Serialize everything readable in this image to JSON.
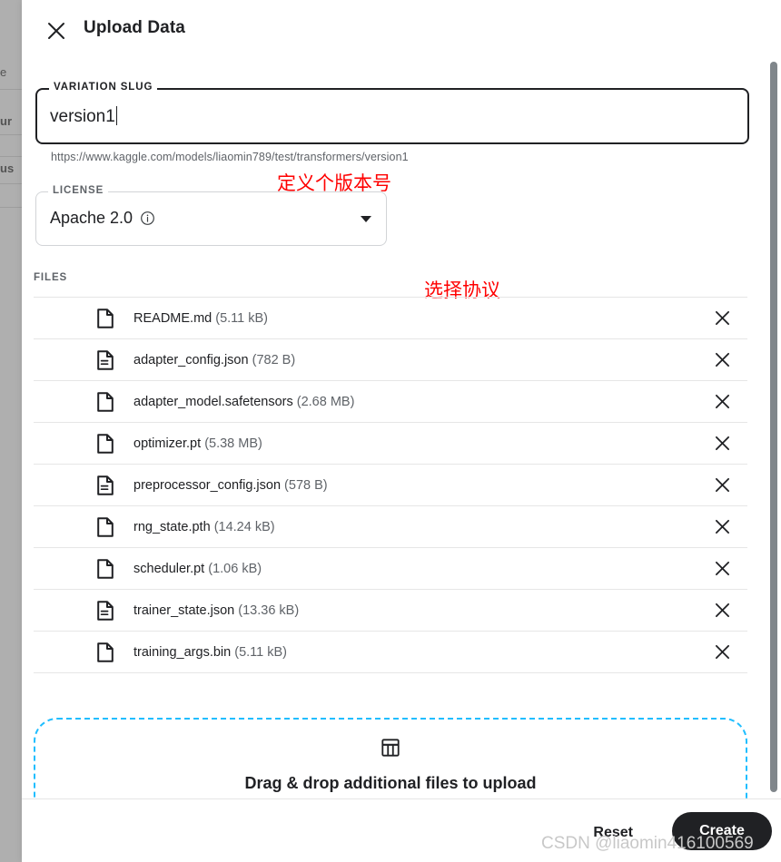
{
  "window": {
    "title": "Upload Data",
    "close_icon": "close-icon"
  },
  "background_page": {
    "fragments": [
      "e",
      "ur",
      "us"
    ]
  },
  "slug_field": {
    "legend": "VARIATION SLUG",
    "value": "version1",
    "url_preview": "https://www.kaggle.com/models/liaomin789/test/transformers/version1"
  },
  "license_field": {
    "legend": "LICENSE",
    "value": "Apache 2.0",
    "info_icon": "info-icon",
    "caret_icon": "chevron-down-icon"
  },
  "annotations": {
    "slug": "定义个版本号",
    "license": "选择协议",
    "color": "#ff0000"
  },
  "files_section": {
    "label": "FILES",
    "remove_icon": "close-icon",
    "items": [
      {
        "name": "README.md",
        "size": "(5.11 kB)",
        "icon": "file-blank-icon"
      },
      {
        "name": "adapter_config.json",
        "size": "(782 B)",
        "icon": "file-lines-icon"
      },
      {
        "name": "adapter_model.safetensors",
        "size": "(2.68 MB)",
        "icon": "file-blank-icon"
      },
      {
        "name": "optimizer.pt",
        "size": "(5.38 MB)",
        "icon": "file-blank-icon"
      },
      {
        "name": "preprocessor_config.json",
        "size": "(578 B)",
        "icon": "file-lines-icon"
      },
      {
        "name": "rng_state.pth",
        "size": "(14.24 kB)",
        "icon": "file-blank-icon"
      },
      {
        "name": "scheduler.pt",
        "size": "(1.06 kB)",
        "icon": "file-blank-icon"
      },
      {
        "name": "trainer_state.json",
        "size": "(13.36 kB)",
        "icon": "file-lines-icon"
      },
      {
        "name": "training_args.bin",
        "size": "(5.11 kB)",
        "icon": "file-blank-icon"
      }
    ]
  },
  "dropzone": {
    "text": "Drag & drop additional files to upload",
    "icon": "table-icon",
    "border_color": "#20beff"
  },
  "footer": {
    "reset_label": "Reset",
    "create_label": "Create",
    "create_bg": "#202124"
  },
  "watermark": {
    "text": "CSDN @liaomin416100569"
  }
}
